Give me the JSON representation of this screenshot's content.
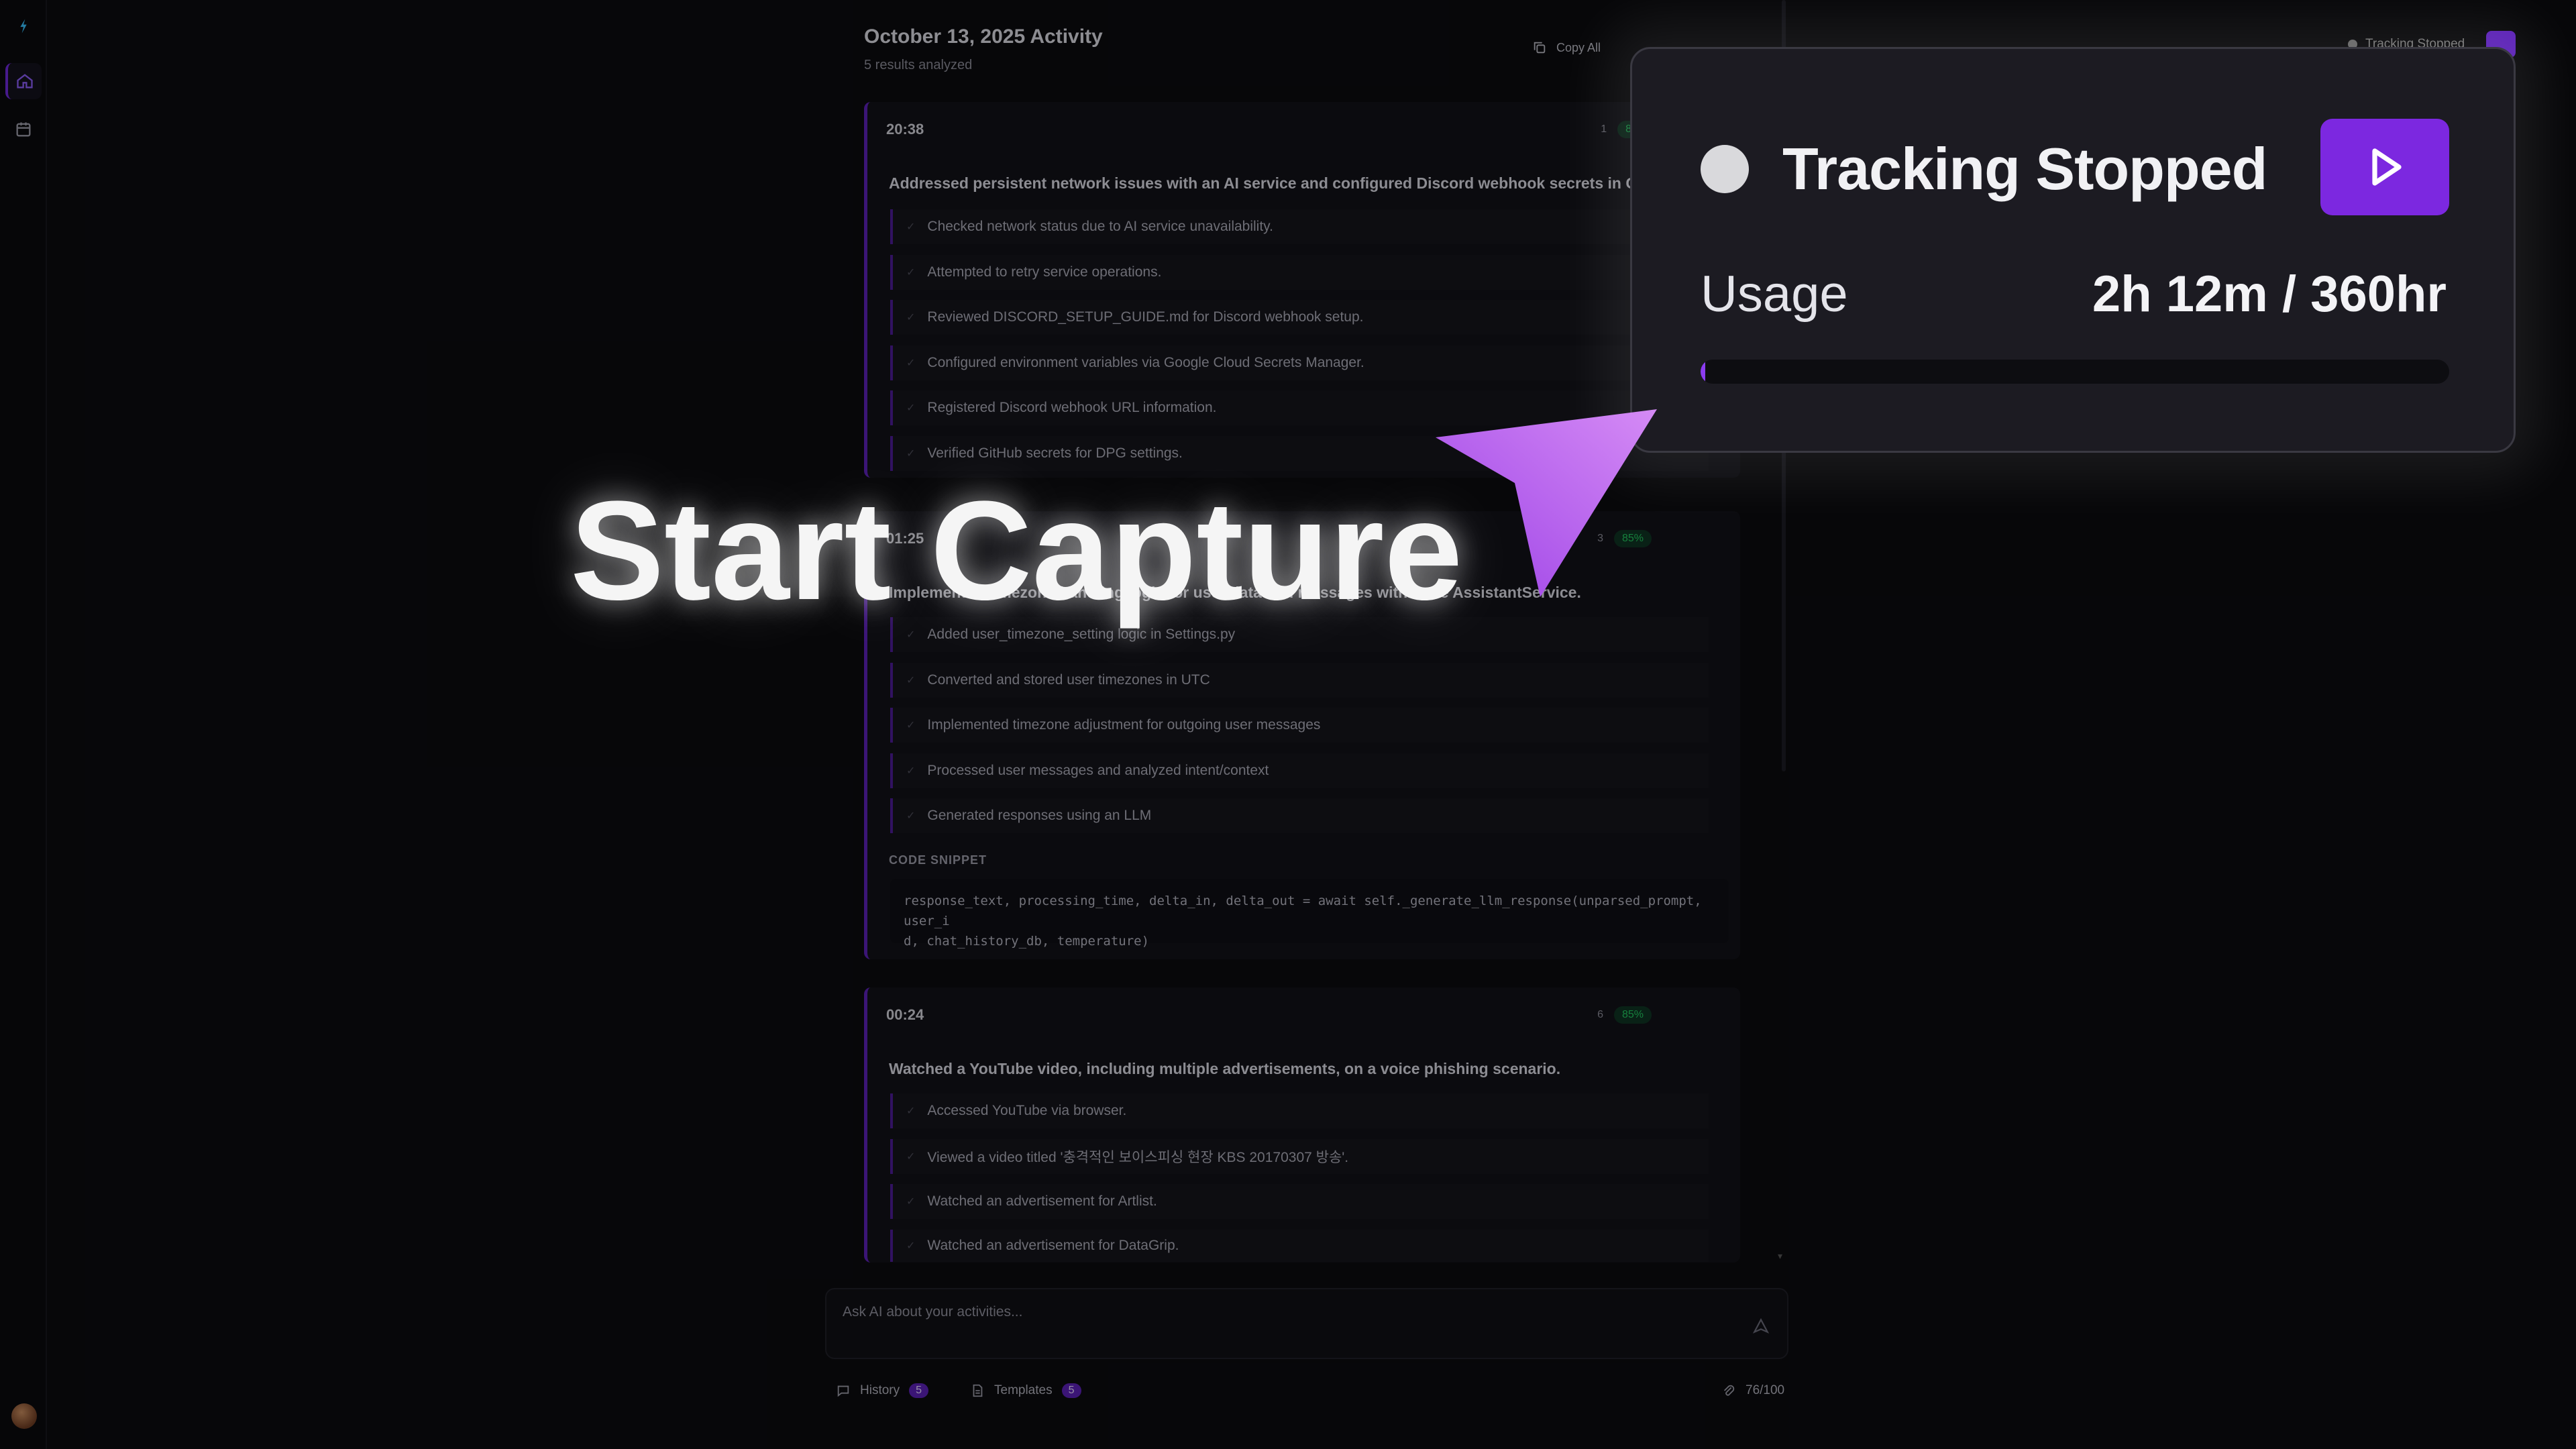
{
  "header": {
    "title": "October 13, 2025 Activity",
    "subtitle": "5 results analyzed",
    "copy_all": "Copy All"
  },
  "cards": [
    {
      "time": "20:38",
      "count": "1",
      "confidence": "8",
      "summary": "Addressed persistent network issues with an AI service and configured Discord webhook secrets in Goo",
      "steps": [
        "Checked network status due to AI service unavailability.",
        "Attempted to retry service operations.",
        "Reviewed DISCORD_SETUP_GUIDE.md for Discord webhook setup.",
        "Configured environment variables via Google Cloud Secrets Manager.",
        "Registered Discord webhook URL information.",
        "Verified GitHub secrets for DPG settings."
      ]
    },
    {
      "time": "01:25",
      "count": "3",
      "confidence": "85%",
      "summary": "Implemented timezone handling logic for user data and messages within the AssistantService.",
      "steps": [
        "Added user_timezone_setting logic in Settings.py",
        "Converted and stored user timezones in UTC",
        "Implemented timezone adjustment for outgoing user messages",
        "Processed user messages and analyzed intent/context",
        "Generated responses using an LLM"
      ],
      "snippet_label": "CODE SNIPPET",
      "snippet_line1": "response_text, processing_time, delta_in, delta_out = await self._generate_llm_response(unparsed_prompt, user_i",
      "snippet_line2": "d, chat_history_db, temperature)"
    },
    {
      "time": "00:24",
      "count": "6",
      "confidence": "85%",
      "summary": "Watched a YouTube video, including multiple advertisements, on a voice phishing scenario.",
      "steps": [
        "Accessed YouTube via browser.",
        "Viewed a video titled '충격적인 보이스피싱 현장 KBS 20170307 방송'.",
        "Watched an advertisement for Artlist.",
        "Watched an advertisement for DataGrip."
      ]
    }
  ],
  "chat": {
    "placeholder": "Ask AI about your activities..."
  },
  "footer": {
    "history_label": "History",
    "history_count": "5",
    "templates_label": "Templates",
    "templates_count": "5",
    "char_count": "76/100"
  },
  "tracking": {
    "status": "Tracking Stopped",
    "usage_label": "Usage",
    "usage_value": "2h 12m / 360hr",
    "usage_fraction": 0.006,
    "accent": "#7c28e0"
  },
  "overlay": {
    "label": "Start Capture"
  },
  "icons": [
    "logo-icon",
    "home-icon",
    "calendar-icon",
    "copy-icon",
    "send-icon",
    "chat-icon",
    "template-icon",
    "attach-icon",
    "play-icon"
  ]
}
